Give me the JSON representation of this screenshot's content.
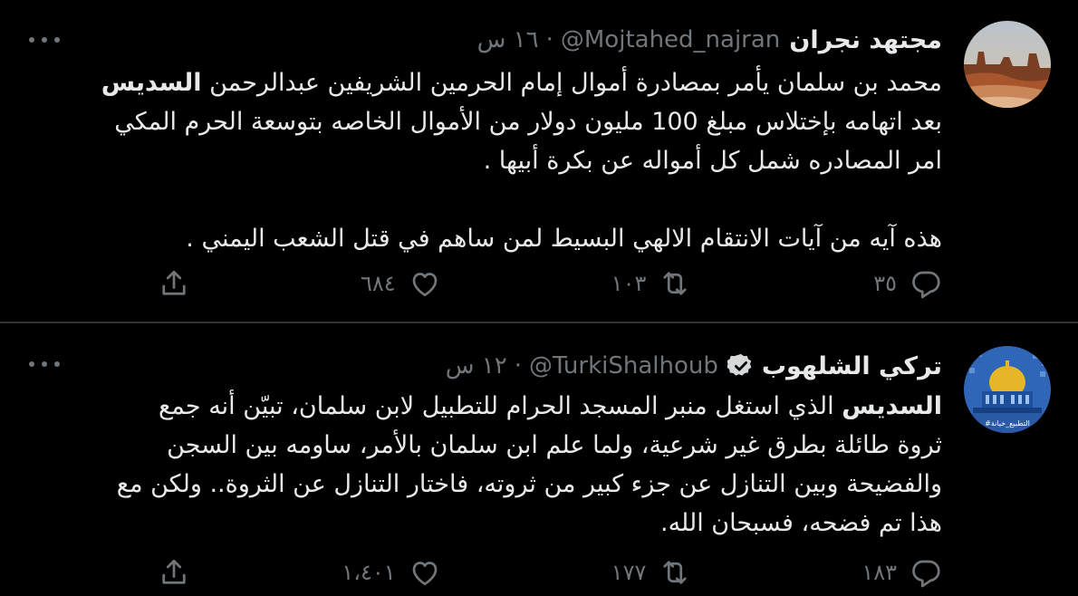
{
  "tweets": [
    {
      "display_name": "مجتهد نجران",
      "handle": "@Mojtahed_najran",
      "separator": "·",
      "time": "١٦ س",
      "verified": false,
      "avatar_icon": "desert-landscape-avatar",
      "body": {
        "line1_pre": "محمد بن سلمان يأمر بمصادرة أموال إمام الحرمين الشريفين عبدالرحمن ",
        "line1_bold": "السديس",
        "line2": "بعد اتهامه بإختلاس مبلغ 100 مليون دولار من الأموال الخاصه بتوسعة الحرم المكي",
        "line3": "امر المصادره شمل كل أمواله عن بكرة أبيها .",
        "line4": "هذه آيه من آيات الانتقام الالهي البسيط لمن ساهم في قتل الشعب اليمني ."
      },
      "actions": {
        "replies": "٣٥",
        "retweets": "١٠٣",
        "likes": "٦٨٤"
      }
    },
    {
      "display_name": "تركي الشلهوب",
      "handle": "@TurkiShalhoub",
      "separator": "·",
      "time": "١٢ س",
      "verified": true,
      "avatar_icon": "dome-of-the-rock-avatar",
      "avatar_caption": "#التطبيع_خيانة",
      "body": {
        "line1_bold": "السديس",
        "line1_post": " الذي استغل منبر المسجد الحرام للتطبيل لابن سلمان، تبيّن أنه جمع",
        "line2": "ثروة طائلة بطرق غير شرعية، ولما علم ابن سلمان بالأمر، ساومه بين السجن",
        "line3": "والفضيحة وبين التنازل عن جزء كبير من ثروته، فاختار التنازل عن الثروة.. ولكن مع",
        "line4": "هذا تم فضحه، فسبحان الله."
      },
      "actions": {
        "replies": "١٨٣",
        "retweets": "١٧٧",
        "likes": "١،٤٠١"
      }
    }
  ],
  "colors": {
    "background": "#000000",
    "text": "#e7e9ea",
    "secondary": "#71767b",
    "divider": "#2f3336"
  }
}
